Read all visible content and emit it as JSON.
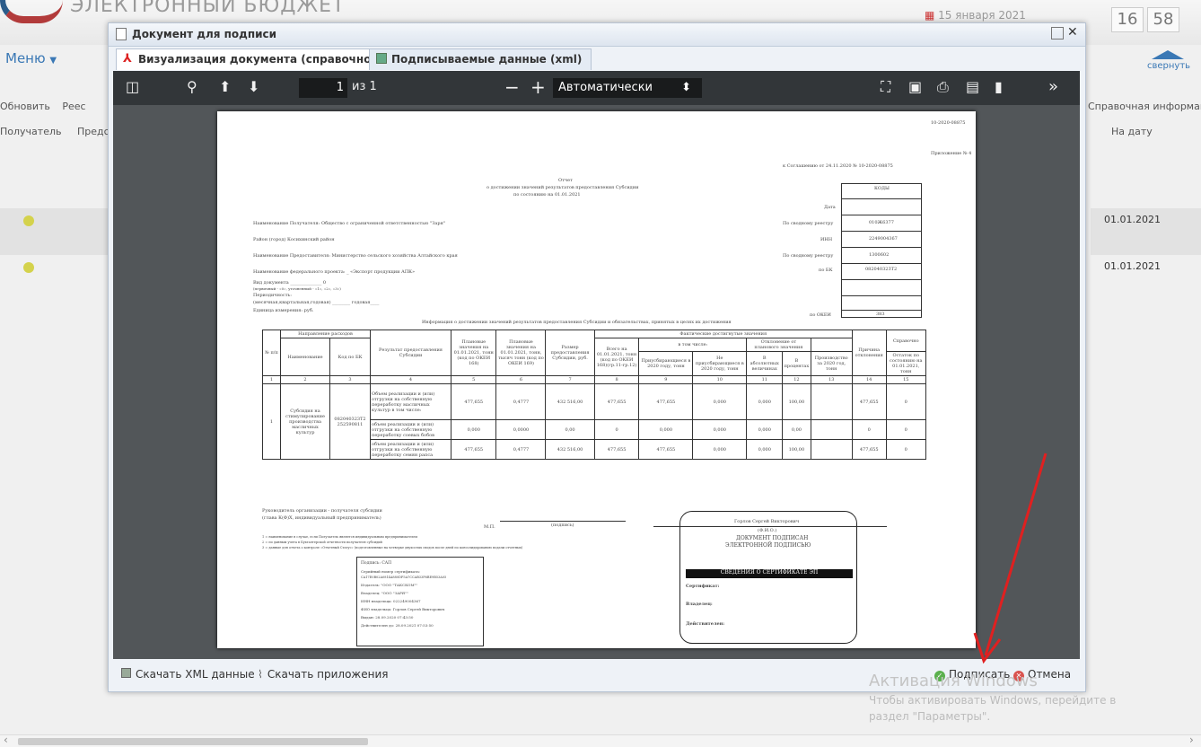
{
  "app": {
    "title": "ЭЛЕКТРОННЫЙ БЮДЖЕТ",
    "date": "15 января 2021",
    "clock_h": "16",
    "clock_m": "58",
    "menu": "Меню",
    "collapse": "свернуть"
  },
  "background": {
    "toolbar": [
      "Обновить",
      "Реес"
    ],
    "col_left": [
      "Получатель",
      "Предс"
    ],
    "col_right": [
      "Справочная информация",
      "На дату"
    ],
    "rows": [
      "01.01.2021",
      "01.01.2021"
    ]
  },
  "dialog": {
    "title": "Документ для подписи",
    "tabs": [
      {
        "label": "Визуализация документа (справочно)"
      },
      {
        "label": "Подписываемые данные (xml)"
      }
    ],
    "viewer": {
      "page_current": "1",
      "page_total": "из 1",
      "zoom": "Автоматически"
    },
    "doc": {
      "corner": "10-2020-08875",
      "appendix": "Приложение № 4",
      "agreement": "к Соглашению от 24.11.2020 № 10-2020-08875",
      "title1": "Отчет",
      "title2": "о достижении значений результатов предоставления Субсидии",
      "title3": "по состоянию на 01.01.2021",
      "codes_header": "КОДЫ",
      "date_label": "Дата",
      "lines": [
        "Наименование Получателя: Общество с ограниченной ответственностью \"Заря\"",
        "Район (город) Косихинский район",
        "Наименование Предоставителя: Министерство сельского хозяйства Алтайского края",
        "Наименование федерального проекта: _ «Экспорт продукции АПК»",
        "Вид документа ______________ 0",
        "(первичный - «0», уточненный - «1», «2», «3»)",
        "Периодичность:",
        "(месячная,квартальная,годовая) ________ годовая____",
        "Единица измерения: руб."
      ],
      "right_labels": [
        "По сводному реестру",
        "ИНН",
        "По сводному реестру",
        "по БК",
        "",
        "",
        "по ОКЕИ"
      ],
      "right_values": [
        "010Ж6377",
        "2249004367",
        "1300602",
        "082040323Т2",
        "",
        "",
        "383"
      ],
      "info_title": "Информация о достижении значений результатов предоставления Субсидии и обязательствах, принятых в целях их достижения",
      "headers": {
        "num": "№ п/п",
        "dir": "Направление расходов",
        "name": "Наименование",
        "kbk": "Код по БК",
        "result": "Результат предоставления Субсидии",
        "plan1": "Плановые значения на 01.01.2021, тонн (код по ОКЕИ 168)",
        "plan2": "Плановые значения на 01.01.2021, тонн, тысяч тонн (код по ОКЕИ 169)",
        "size": "Размер предоставления Субсидии, руб.",
        "fact": "Фактические достигнутые значения",
        "total": "Всего на 01.01.2021, тонн (код по ОКЕИ 168)(гр.11-гр.12)",
        "incl": "в том числе:",
        "pri": "Приусбирающиеся в 2020 году, тонн",
        "nepri": "Не приусбирающиеся в 2020 году, тонн",
        "dev": "Отклонение от планового значения",
        "abs": "В абсолютных величинах",
        "pct": "В процентах",
        "reason": "Причина отклонения",
        "ref": "Справочно",
        "prod": "Производство за 2020 год, тонн",
        "rest": "Остаток по состоянию на 01.01.2021, тонн"
      },
      "colnums": [
        "1",
        "2",
        "3",
        "4",
        "5",
        "6",
        "7",
        "8",
        "9",
        "10",
        "11",
        "12",
        "13",
        "14",
        "15"
      ],
      "row_num": "1",
      "row_name": "Субсидия на стимулирование производства масличных культур",
      "row_kbk": "082040323Т2 252590811",
      "subrows": [
        [
          "Объем реализации и (или) отгрузки на собственную переработку масличных культур в том числе:",
          "477,655",
          "0,4777",
          "432 516,00",
          "477,655",
          "477,655",
          "0,000",
          "0,000",
          "100,00",
          "",
          "477,655",
          "0"
        ],
        [
          "объем реализации и (или) отгрузки на собственную переработку соевых бобов",
          "0,000",
          "0,0000",
          "0,00",
          "0",
          "0,000",
          "0,000",
          "0,000",
          "0,00",
          "",
          "0",
          "0"
        ],
        [
          "объем реализации и (или) отгрузки на собственную переработку семян рапса",
          "477,655",
          "0,4777",
          "432 516,00",
          "477,655",
          "477,655",
          "0,000",
          "0,000",
          "100,00",
          "",
          "477,655",
          "0"
        ]
      ],
      "sign_left1": "Руководитель организации - получателя субсидии",
      "sign_left2": "(глава К(Ф)Х, индивидуальный предприниматель)",
      "mp": "М.П.",
      "sig": "(подпись)",
      "fn": [
        "1 = наименование в случае, если Получатель является индивидуальным предпринимателем",
        "2 = по данным учета в Бухгалтерской отчетности получателя субсидий",
        "3 = данные для отчета о контроле «Отчетный Статус» (подготовленные на четверке двухсотых сводов после дней по консолидированию подачи отчетных)"
      ],
      "small_stamp": [
        "Подпись: САП",
        "Серийный номер сертификата:",
        "CA17E0B02A0814A880DF5A7CCAB33F6BE9B53A05",
        "Издатель: \"ООО \"ТАКСКОМ\"\"",
        "Владелец: \"ООО \"ЗАРЯ\"\"",
        "ИНН владельца: 022249004367",
        "ФИО владельца: Горлов Сергей Викторович",
        "Выдан: 28.09.2020 07:43:50",
        "Действителен до: 28.09.2021 07:53:50"
      ],
      "signer": "Горлов Сергей Викторович",
      "fio": "(Ф.И.О.)",
      "signed1": "ДОКУМЕНТ ПОДПИСАН",
      "signed2": "ЭЛЕКТРОННОЙ ПОДПИСЬЮ",
      "cert": "СВЕДЕНИЯ О СЕРТИФИКАТЕ ЭП",
      "cert_fields": [
        "Сертификат:",
        "Владелец:",
        "Действителен:"
      ]
    },
    "download_xml": "Скачать XML данные",
    "download_att": "Скачать приложения",
    "sign": "Подписать",
    "cancel": "Отмена"
  },
  "watermark": {
    "l1": "Активация Windows",
    "l2": "Чтобы активировать Windows, перейдите в",
    "l3": "раздел \"Параметры\"."
  }
}
